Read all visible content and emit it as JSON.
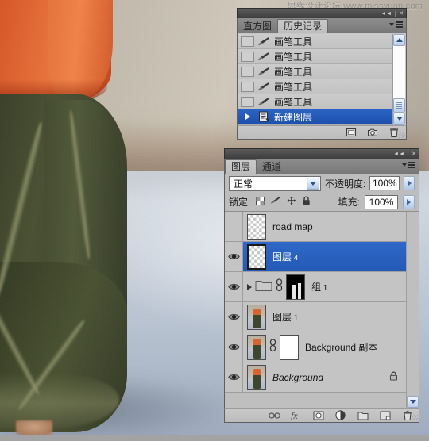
{
  "watermark": "思缘设计论坛 www.missyuan.com",
  "history_panel": {
    "name": "history-panel",
    "titlebar": {
      "collapse": "◄◄",
      "close": "✕"
    },
    "tabs": [
      {
        "label": "直方图",
        "active": false
      },
      {
        "label": "历史记录",
        "active": true
      }
    ],
    "items": [
      {
        "label": "画笔工具",
        "icon": "brush-icon",
        "selected": false
      },
      {
        "label": "画笔工具",
        "icon": "brush-icon",
        "selected": false
      },
      {
        "label": "画笔工具",
        "icon": "brush-icon",
        "selected": false
      },
      {
        "label": "画笔工具",
        "icon": "brush-icon",
        "selected": false
      },
      {
        "label": "画笔工具",
        "icon": "brush-icon",
        "selected": false
      },
      {
        "label": "新建图层",
        "icon": "new-layer-history-icon",
        "selected": true
      }
    ],
    "footer_buttons": [
      "new-document-from-state-icon",
      "new-snapshot-camera-icon",
      "delete-trash-icon"
    ]
  },
  "layers_panel": {
    "name": "layers-panel",
    "titlebar": {
      "collapse": "◄◄",
      "close": "✕"
    },
    "tabs": [
      {
        "label": "图层",
        "active": true
      },
      {
        "label": "通道",
        "active": false
      }
    ],
    "blend_mode": {
      "label": "正常"
    },
    "opacity": {
      "label": "不透明度:",
      "value": "100%"
    },
    "lock": {
      "label": "锁定:",
      "icons": [
        "lock-transparency-icon",
        "lock-image-icon",
        "lock-position-icon",
        "lock-all-icon"
      ]
    },
    "fill": {
      "label": "填充:",
      "value": "100%"
    },
    "rows": [
      {
        "name": "road map",
        "visible": false,
        "selected": false,
        "thumb": "checker",
        "has_link": false,
        "has_mask": false,
        "is_group": false,
        "locked": false,
        "italic": false
      },
      {
        "name": "图层",
        "suffix": " 4",
        "visible": true,
        "selected": true,
        "thumb": "checker",
        "has_link": false,
        "has_mask": false,
        "is_group": false,
        "locked": false,
        "italic": false
      },
      {
        "name": "组",
        "suffix": " 1",
        "visible": true,
        "selected": false,
        "thumb": "folder",
        "has_link": true,
        "has_mask": true,
        "mask_type": "black",
        "is_group": true,
        "locked": false,
        "italic": false
      },
      {
        "name": "图层",
        "suffix": " 1",
        "visible": true,
        "selected": false,
        "thumb": "photo",
        "has_link": false,
        "has_mask": false,
        "is_group": false,
        "locked": false,
        "italic": false
      },
      {
        "name": "Background 副本",
        "visible": true,
        "selected": false,
        "thumb": "photo",
        "has_link": true,
        "has_mask": true,
        "mask_type": "white",
        "is_group": false,
        "locked": false,
        "italic": false
      },
      {
        "name": "Background",
        "visible": true,
        "selected": false,
        "thumb": "photo",
        "has_link": false,
        "has_mask": false,
        "is_group": false,
        "locked": true,
        "italic": true
      }
    ],
    "footer_buttons": [
      "link-layers-icon",
      "layer-style-fx-icon",
      "add-layer-mask-icon",
      "adjustment-layer-icon",
      "new-group-folder-icon",
      "new-layer-icon",
      "delete-layer-trash-icon"
    ]
  }
}
